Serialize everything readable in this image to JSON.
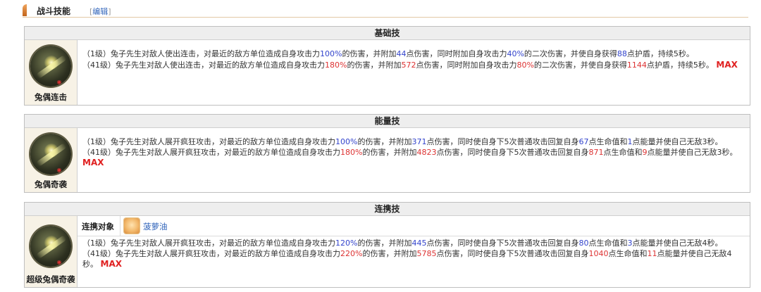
{
  "section": {
    "title": "战斗技能",
    "edit_open": "[",
    "edit_label": "编辑",
    "edit_close": "]"
  },
  "skills": [
    {
      "header": "基础技",
      "name": "兔偶连击",
      "line1": [
        "（1级）兔子先生对敌人使出连击，对最近的敌方单位造成自身攻击力",
        "100%",
        "的伤害，并附加",
        "44",
        "点伤害，同时附加自身攻击力",
        "40%",
        "的二次伤害，并使自身获得",
        "88",
        "点护盾，持续5秒。"
      ],
      "line2": [
        "（41级）兔子先生对敌人使出连击，对最近的敌方单位造成自身攻击力",
        "180%",
        "的伤害，并附加",
        "572",
        "点伤害，同时附加自身攻击力",
        "80%",
        "的二次伤害，并使自身获得",
        "1144",
        "点护盾，持续5秒。"
      ],
      "max": "MAX"
    },
    {
      "header": "能量技",
      "name": "兔偶奇袭",
      "line1": [
        "（1级）兔子先生对敌人展开疯狂攻击，对最近的敌方单位造成自身攻击力",
        "100%",
        "的伤害，并附加",
        "371",
        "点伤害，同时使自身下5次普通攻击回复自身",
        "67",
        "点生命值和",
        "1",
        "点能量并使自己无敌3秒。"
      ],
      "line2": [
        "（41级）兔子先生对敌人展开疯狂攻击，对最近的敌方单位造成自身攻击力",
        "180%",
        "的伤害，并附加",
        "4823",
        "点伤害，同时使自身下5次普通攻击回复自身",
        "871",
        "点生命值和",
        "9",
        "点能量并使自己无敌3秒。"
      ],
      "max": "MAX"
    },
    {
      "header": "连携技",
      "name": "超级兔偶奇袭",
      "partner_label": "连携对象",
      "partner_name": "菠萝油",
      "line1": [
        "（1级）兔子先生对敌人展开疯狂攻击，对最近的敌方单位造成自身攻击力",
        "120%",
        "的伤害，并附加",
        "445",
        "点伤害，同时使自身下5次普通攻击回复自身",
        "80",
        "点生命值和",
        "3",
        "点能量并使自己无敌4秒。"
      ],
      "line2": [
        "（41级）兔子先生对敌人展开疯狂攻击，对最近的敌方单位造成自身攻击力",
        "220%",
        "的伤害，并附加",
        "5785",
        "点伤害，同时使自身下5次普通攻击回复自身",
        "1040",
        "点生命值和",
        "11",
        "点能量并使自己无敌4秒。"
      ],
      "max": "MAX"
    }
  ],
  "colors": {
    "blue": "#3344cc",
    "red": "#dd3333",
    "max": "#e02020"
  }
}
